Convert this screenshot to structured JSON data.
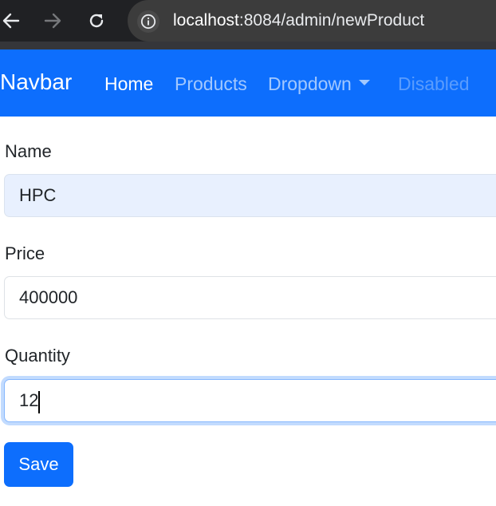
{
  "browser": {
    "url_host": "localhost",
    "url_path": ":8084/admin/newProduct"
  },
  "navbar": {
    "brand": "Navbar",
    "links": [
      {
        "label": "Home",
        "state": "active"
      },
      {
        "label": "Products",
        "state": "normal"
      },
      {
        "label": "Dropdown",
        "state": "normal"
      },
      {
        "label": "Disabled",
        "state": "disabled"
      }
    ]
  },
  "form": {
    "name": {
      "label": "Name",
      "value": "HPC"
    },
    "price": {
      "label": "Price",
      "value": "400000"
    },
    "quantity": {
      "label": "Quantity",
      "value": "12"
    },
    "save_label": "Save"
  },
  "colors": {
    "navbar_bg": "#0d6efd",
    "button_bg": "#0d6efd",
    "autofill_bg": "#e8f0fe"
  }
}
